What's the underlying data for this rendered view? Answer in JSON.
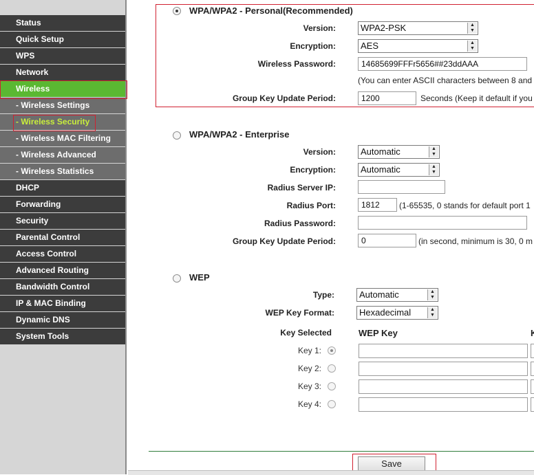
{
  "sidebar": {
    "items": [
      {
        "label": "Status",
        "type": "main"
      },
      {
        "label": "Quick Setup",
        "type": "main"
      },
      {
        "label": "WPS",
        "type": "main"
      },
      {
        "label": "Network",
        "type": "main"
      },
      {
        "label": "Wireless",
        "type": "main",
        "active": true
      },
      {
        "label": "- Wireless Settings",
        "type": "sub"
      },
      {
        "label": "- Wireless Security",
        "type": "sub",
        "current": true
      },
      {
        "label": "- Wireless MAC Filtering",
        "type": "sub"
      },
      {
        "label": "- Wireless Advanced",
        "type": "sub"
      },
      {
        "label": "- Wireless Statistics",
        "type": "sub"
      },
      {
        "label": "DHCP",
        "type": "main"
      },
      {
        "label": "Forwarding",
        "type": "main"
      },
      {
        "label": "Security",
        "type": "main"
      },
      {
        "label": "Parental Control",
        "type": "main"
      },
      {
        "label": "Access Control",
        "type": "main"
      },
      {
        "label": "Advanced Routing",
        "type": "main"
      },
      {
        "label": "Bandwidth Control",
        "type": "main"
      },
      {
        "label": "IP & MAC Binding",
        "type": "main"
      },
      {
        "label": "Dynamic DNS",
        "type": "main"
      },
      {
        "label": "System Tools",
        "type": "main"
      }
    ]
  },
  "personal": {
    "title": "WPA/WPA2 - Personal(Recommended)",
    "version_label": "Version:",
    "version_value": "WPA2-PSK",
    "encryption_label": "Encryption:",
    "encryption_value": "AES",
    "password_label": "Wireless Password:",
    "password_value": "14685699FFFr5656##23ddAAA",
    "password_hint": "(You can enter ASCII characters between 8 and",
    "gkup_label": "Group Key Update Period:",
    "gkup_value": "1200",
    "gkup_hint": "Seconds (Keep it default if you"
  },
  "enterprise": {
    "title": "WPA/WPA2 - Enterprise",
    "version_label": "Version:",
    "version_value": "Automatic",
    "encryption_label": "Encryption:",
    "encryption_value": "Automatic",
    "radius_ip_label": "Radius Server IP:",
    "radius_ip_value": "",
    "radius_port_label": "Radius Port:",
    "radius_port_value": "1812",
    "radius_port_hint": "(1-65535, 0 stands for default port 1",
    "radius_pw_label": "Radius Password:",
    "radius_pw_value": "",
    "gkup_label": "Group Key Update Period:",
    "gkup_value": "0",
    "gkup_hint": "(in second, minimum is 30, 0 m"
  },
  "wep": {
    "title": "WEP",
    "type_label": "Type:",
    "type_value": "Automatic",
    "format_label": "WEP Key Format:",
    "format_value": "Hexadecimal",
    "key_selected_header": "Key Selected",
    "wep_key_header": "WEP Key",
    "clipped_header": "K",
    "keys": [
      {
        "label": "Key 1:",
        "selected": true
      },
      {
        "label": "Key 2:",
        "selected": false
      },
      {
        "label": "Key 3:",
        "selected": false
      },
      {
        "label": "Key 4:",
        "selected": false
      }
    ]
  },
  "save_label": "Save",
  "colors": {
    "nav_dark": "#3c3c3c",
    "nav_sub": "#6d6d6d",
    "nav_active": "#5ab832",
    "highlight_box": "#d02030"
  }
}
